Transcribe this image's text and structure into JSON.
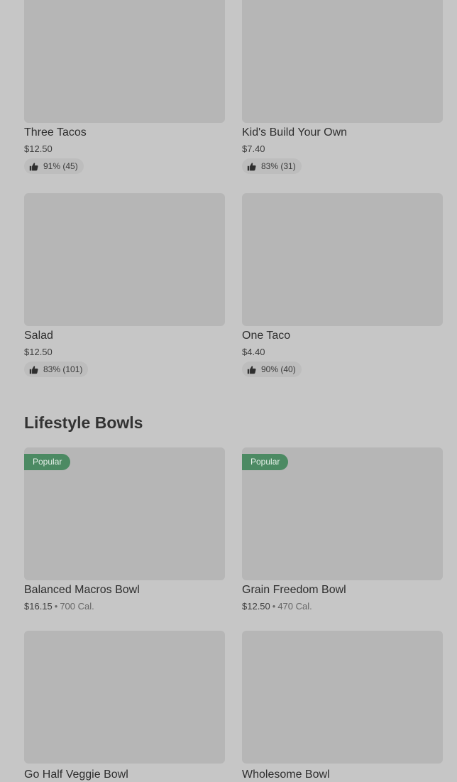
{
  "grid_top": [
    {
      "name": "Three Tacos",
      "price": "$12.50",
      "rating": "91% (45)"
    },
    {
      "name": "Kid's Build Your Own",
      "price": "$7.40",
      "rating": "83% (31)"
    },
    {
      "name": "Salad",
      "price": "$12.50",
      "rating": "83% (101)"
    },
    {
      "name": "One Taco",
      "price": "$4.40",
      "rating": "90% (40)"
    }
  ],
  "lifestyle": {
    "heading": "Lifestyle Bowls",
    "items": [
      {
        "badge": "Popular",
        "name": "Balanced Macros Bowl",
        "price": "$16.15",
        "separator": "•",
        "calories": "700 Cal."
      },
      {
        "badge": "Popular",
        "name": "Grain Freedom Bowl",
        "price": "$12.50",
        "separator": "•",
        "calories": "470 Cal."
      },
      {
        "name": "Go Half Veggie Bowl"
      },
      {
        "name": "Wholesome Bowl"
      }
    ]
  },
  "icons": {
    "rating": "thumbs-up-icon"
  },
  "colors": {
    "background": "#c6c6c6",
    "image_placeholder": "#b6b6b6",
    "rating_pill": "#bdbdbd",
    "popular_badge": "#4c8a63"
  }
}
